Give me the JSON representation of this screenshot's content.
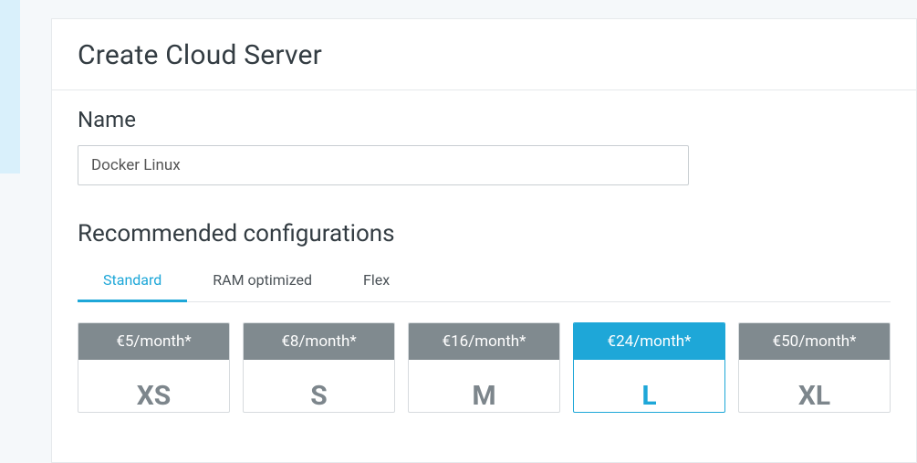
{
  "title": "Create Cloud Server",
  "name": {
    "label": "Name",
    "value": "Docker Linux"
  },
  "configs": {
    "heading": "Recommended configurations",
    "tabs": [
      {
        "label": "Standard",
        "active": true
      },
      {
        "label": "RAM optimized",
        "active": false
      },
      {
        "label": "Flex",
        "active": false
      }
    ],
    "plans": [
      {
        "price": "€5/month*",
        "size": "XS",
        "selected": false
      },
      {
        "price": "€8/month*",
        "size": "S",
        "selected": false
      },
      {
        "price": "€16/month*",
        "size": "M",
        "selected": false
      },
      {
        "price": "€24/month*",
        "size": "L",
        "selected": true
      },
      {
        "price": "€50/month*",
        "size": "XL",
        "selected": false
      }
    ]
  }
}
